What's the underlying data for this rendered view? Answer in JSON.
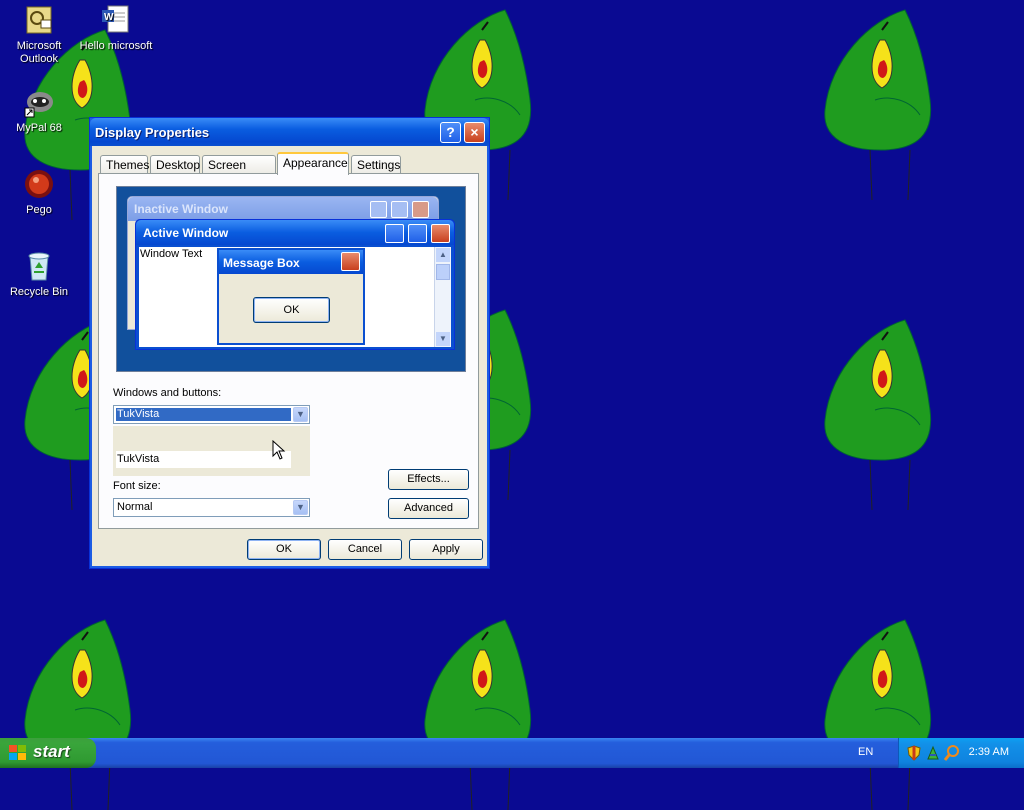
{
  "desktop": {
    "icons": [
      {
        "label_line1": "Microsoft",
        "label_line2": "Outlook",
        "icon": "outlook-icon"
      },
      {
        "label_line1": "Hello microsoft",
        "label_line2": "",
        "icon": "word-document-icon"
      },
      {
        "label_line1": "MyPal 68",
        "label_line2": "",
        "icon": "mypal-browser-icon"
      },
      {
        "label_line1": "Pego",
        "label_line2": "",
        "icon": "pego-icon"
      },
      {
        "label_line1": "Recycle Bin",
        "label_line2": "",
        "icon": "recycle-bin-icon"
      }
    ]
  },
  "dialog": {
    "title": "Display Properties",
    "help_glyph": "?",
    "close_glyph": "×",
    "tabs": [
      {
        "label": "Themes",
        "active": false
      },
      {
        "label": "Desktop",
        "active": false
      },
      {
        "label": "Screen Saver",
        "active": false
      },
      {
        "label": "Appearance",
        "active": true
      },
      {
        "label": "Settings",
        "active": false
      }
    ],
    "preview": {
      "inactive_title": "Inactive Window",
      "active_title": "Active Window",
      "window_text": "Window Text",
      "message_box_title": "Message Box",
      "message_box_ok": "OK"
    },
    "windows_and_buttons": {
      "label": "Windows and buttons:",
      "selected": "TukVista",
      "list_item": "TukVista"
    },
    "font_size": {
      "label": "Font size:",
      "selected": "Normal"
    },
    "effects_button": "Effects...",
    "advanced_button": "Advanced",
    "ok_button": "OK",
    "cancel_button": "Cancel",
    "apply_button": "Apply"
  },
  "taskbar": {
    "start_label": "start",
    "language": "EN",
    "clock": "2:39 AM",
    "tray_icons": [
      "security-shield-icon",
      "network-icon",
      "search-icon"
    ]
  },
  "colors": {
    "desktop_background": "#0a0a92",
    "wallpaper_figure": "#1f9c1f",
    "xp_blue": "#0a5de0",
    "start_green": "#2f9a31"
  }
}
